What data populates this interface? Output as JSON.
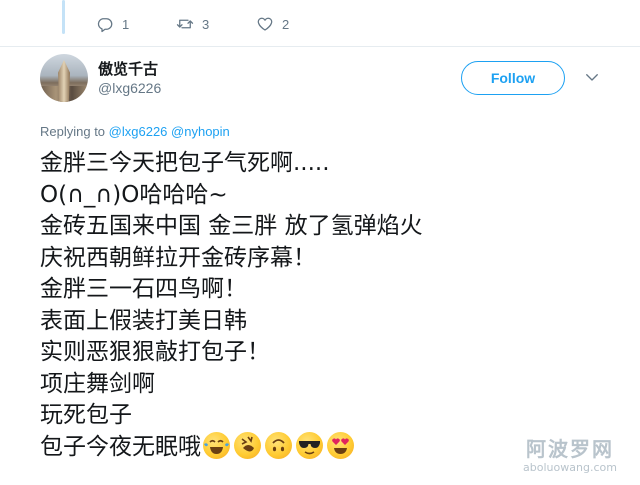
{
  "previous_tweet": {
    "actions": [
      {
        "name": "reply",
        "icon": "reply-icon",
        "count": "1"
      },
      {
        "name": "retweet",
        "icon": "retweet-icon",
        "count": "3"
      },
      {
        "name": "like",
        "icon": "heart-icon",
        "count": "2"
      }
    ]
  },
  "tweet": {
    "author": {
      "display_name": "傲览千古",
      "handle": "@lxg6226"
    },
    "follow_label": "Follow",
    "menu_icon": "chevron-down-icon",
    "replying_to_label": "Replying to",
    "replying_to": [
      "@lxg6226",
      "@nyhopin"
    ],
    "lines": [
      "金胖三今天把包子气死啊.....",
      "O(∩_∩)O哈哈哈~",
      "金砖五国来中国 金三胖 放了氢弹焰火",
      "庆祝西朝鲜拉开金砖序幕！",
      "金胖三一石四鸟啊！",
      "表面上假装打美日韩",
      "实则恶狠狠敲打包子！",
      "项庄舞剑啊",
      "玩死包子",
      "包子今夜无眠哦"
    ],
    "emojis": [
      "tears-of-joy-emoji",
      "rolling-on-floor-laughing-emoji",
      "upside-down-face-emoji",
      "sunglasses-face-emoji",
      "heart-eyes-emoji"
    ]
  },
  "watermark": {
    "title": "阿波罗网",
    "url": "aboluowang.com"
  },
  "colors": {
    "accent": "#1da1f2",
    "muted": "#657786",
    "text": "#14171a",
    "thread_line": "#c4e2f7"
  }
}
